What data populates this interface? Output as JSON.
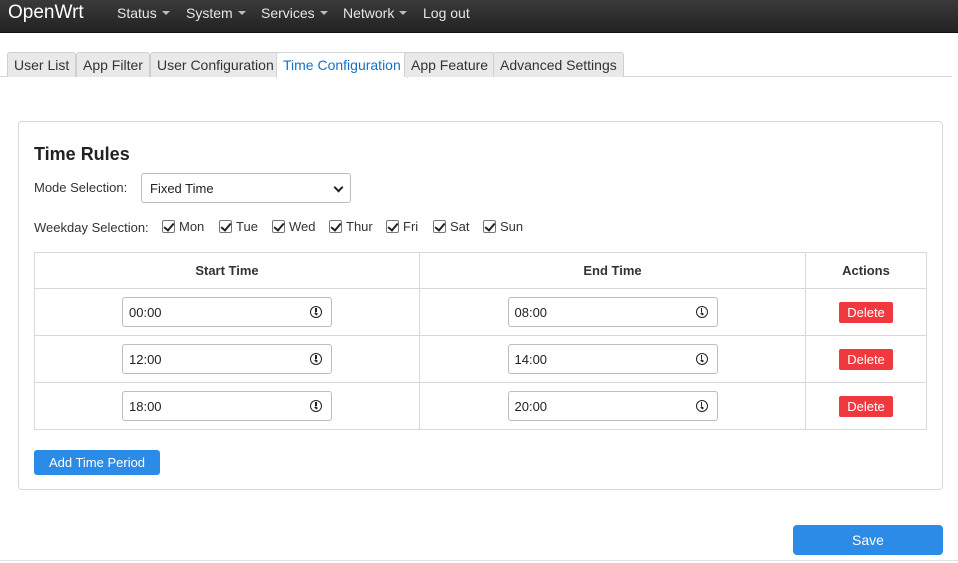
{
  "navbar": {
    "brand": "OpenWrt",
    "items": [
      {
        "label": "Status",
        "dropdown": true
      },
      {
        "label": "System",
        "dropdown": true
      },
      {
        "label": "Services",
        "dropdown": true
      },
      {
        "label": "Network",
        "dropdown": true
      },
      {
        "label": "Log out",
        "dropdown": false
      }
    ]
  },
  "tabs": [
    {
      "label": "User List",
      "active": false
    },
    {
      "label": "App Filter",
      "active": false
    },
    {
      "label": "User Configuration",
      "active": false
    },
    {
      "label": "Time Configuration",
      "active": true
    },
    {
      "label": "App Feature",
      "active": false
    },
    {
      "label": "Advanced Settings",
      "active": false
    }
  ],
  "time_rules": {
    "title": "Time Rules",
    "mode_label": "Mode Selection:",
    "mode_value": "Fixed Time",
    "weekday_label": "Weekday Selection:",
    "weekdays": [
      {
        "label": "Mon",
        "checked": true
      },
      {
        "label": "Tue",
        "checked": true
      },
      {
        "label": "Wed",
        "checked": true
      },
      {
        "label": "Thur",
        "checked": true
      },
      {
        "label": "Fri",
        "checked": true
      },
      {
        "label": "Sat",
        "checked": true
      },
      {
        "label": "Sun",
        "checked": true
      }
    ],
    "table": {
      "headers": [
        "Start Time",
        "End Time",
        "Actions"
      ],
      "rows": [
        {
          "start": "00:00",
          "end": "08:00",
          "action": "Delete"
        },
        {
          "start": "12:00",
          "end": "14:00",
          "action": "Delete"
        },
        {
          "start": "18:00",
          "end": "20:00",
          "action": "Delete"
        }
      ]
    },
    "add_button": "Add Time Period"
  },
  "save_button": "Save",
  "colors": {
    "primary": "#2b8be6",
    "danger": "#f0393f",
    "active_tab": "#1a6fc2",
    "navbar": "#2b2b2b"
  }
}
